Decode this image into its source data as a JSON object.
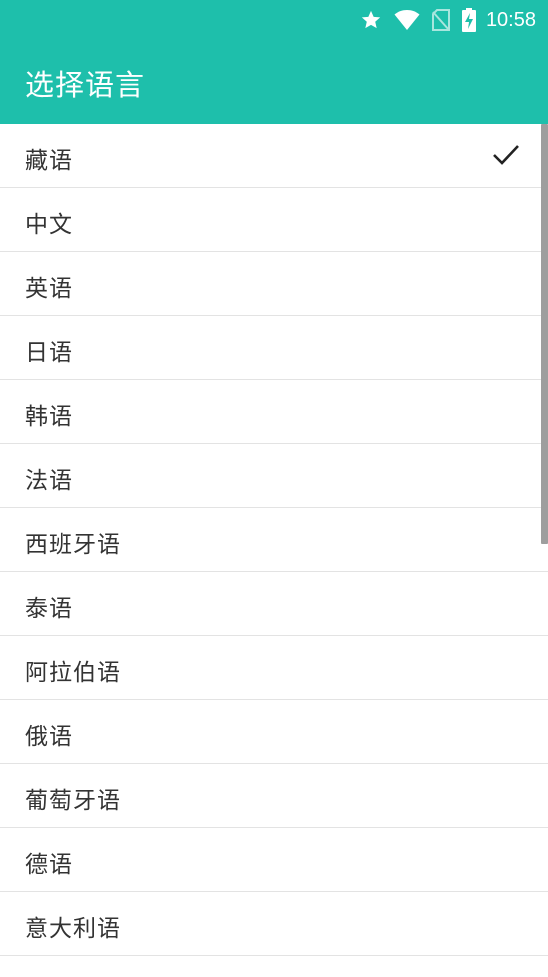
{
  "status_bar": {
    "time": "10:58",
    "icons": [
      "star-icon",
      "wifi-icon",
      "no-sim-icon",
      "battery-charging-icon"
    ]
  },
  "app_bar": {
    "title": "选择语言"
  },
  "languages": [
    {
      "label": "藏语",
      "selected": true
    },
    {
      "label": "中文",
      "selected": false
    },
    {
      "label": "英语",
      "selected": false
    },
    {
      "label": "日语",
      "selected": false
    },
    {
      "label": "韩语",
      "selected": false
    },
    {
      "label": "法语",
      "selected": false
    },
    {
      "label": "西班牙语",
      "selected": false
    },
    {
      "label": "泰语",
      "selected": false
    },
    {
      "label": "阿拉伯语",
      "selected": false
    },
    {
      "label": "俄语",
      "selected": false
    },
    {
      "label": "葡萄牙语",
      "selected": false
    },
    {
      "label": "德语",
      "selected": false
    },
    {
      "label": "意大利语",
      "selected": false
    }
  ],
  "colors": {
    "accent": "#1ebfab",
    "text": "#333333",
    "divider": "#e3e3e3"
  }
}
